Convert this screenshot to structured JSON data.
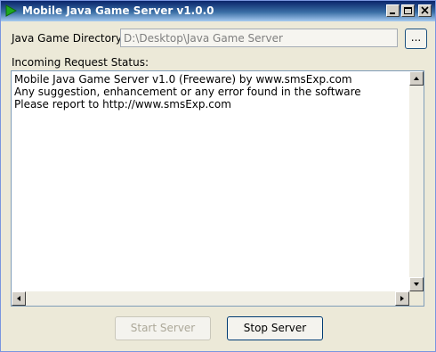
{
  "window": {
    "title": "Mobile Java Game Server v1.0.0"
  },
  "directory": {
    "label": "Java Game Directory:",
    "value": "D:\\Desktop\\Java Game Server",
    "browse_label": "..."
  },
  "status": {
    "label": "Incoming Request Status:",
    "text": "Mobile Java Game Server v1.0 (Freeware) by www.smsExp.com\nAny suggestion, enhancement or any error found in the software\nPlease report to http://www.smsExp.com"
  },
  "buttons": {
    "start_label": "Start Server",
    "stop_label": "Stop Server"
  },
  "icons": {
    "app": "play-arrow-icon",
    "minimize": "minimize-icon",
    "maximize": "maximize-icon",
    "close": "close-icon"
  },
  "colors": {
    "titlebar": "#0a246a",
    "app_icon": "#1faa1f",
    "disabled_text": "#aca899"
  }
}
